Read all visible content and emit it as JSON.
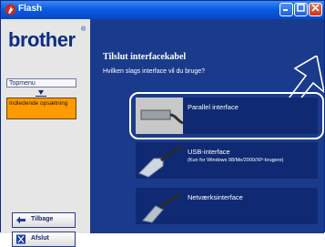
{
  "window": {
    "title": "Flash",
    "icons": {
      "app": "flash-app-icon",
      "minimize": "minimize-icon",
      "maximize": "maximize-icon",
      "close": "close-icon"
    }
  },
  "sidebar": {
    "logo": "brother",
    "logo_mark": "®",
    "nav": {
      "top_label": "Topmenu",
      "current_label": "Indledende opsætning"
    },
    "buttons": {
      "back_label": "Tilbage",
      "exit_label": "Afslut"
    },
    "colors": {
      "current": "#ff9a00",
      "logo": "#0c2d83"
    }
  },
  "main": {
    "title": "Tilslut interfacekabel",
    "question": "Hvilken slags interface vil du bruge?",
    "options": [
      {
        "label": "Parallel interface",
        "sub": "",
        "selected": true,
        "icon": "parallel-cable-icon"
      },
      {
        "label": "USB-interface",
        "sub": "(Kun for Windows 98/Me/2000/XP-brugere)",
        "selected": false,
        "icon": "usb-cable-icon"
      },
      {
        "label": "Netværksinterface",
        "sub": "",
        "selected": false,
        "icon": "network-cable-icon"
      }
    ],
    "colors": {
      "background": "#1a3b8c",
      "option_bg": "#0f2a72"
    }
  }
}
